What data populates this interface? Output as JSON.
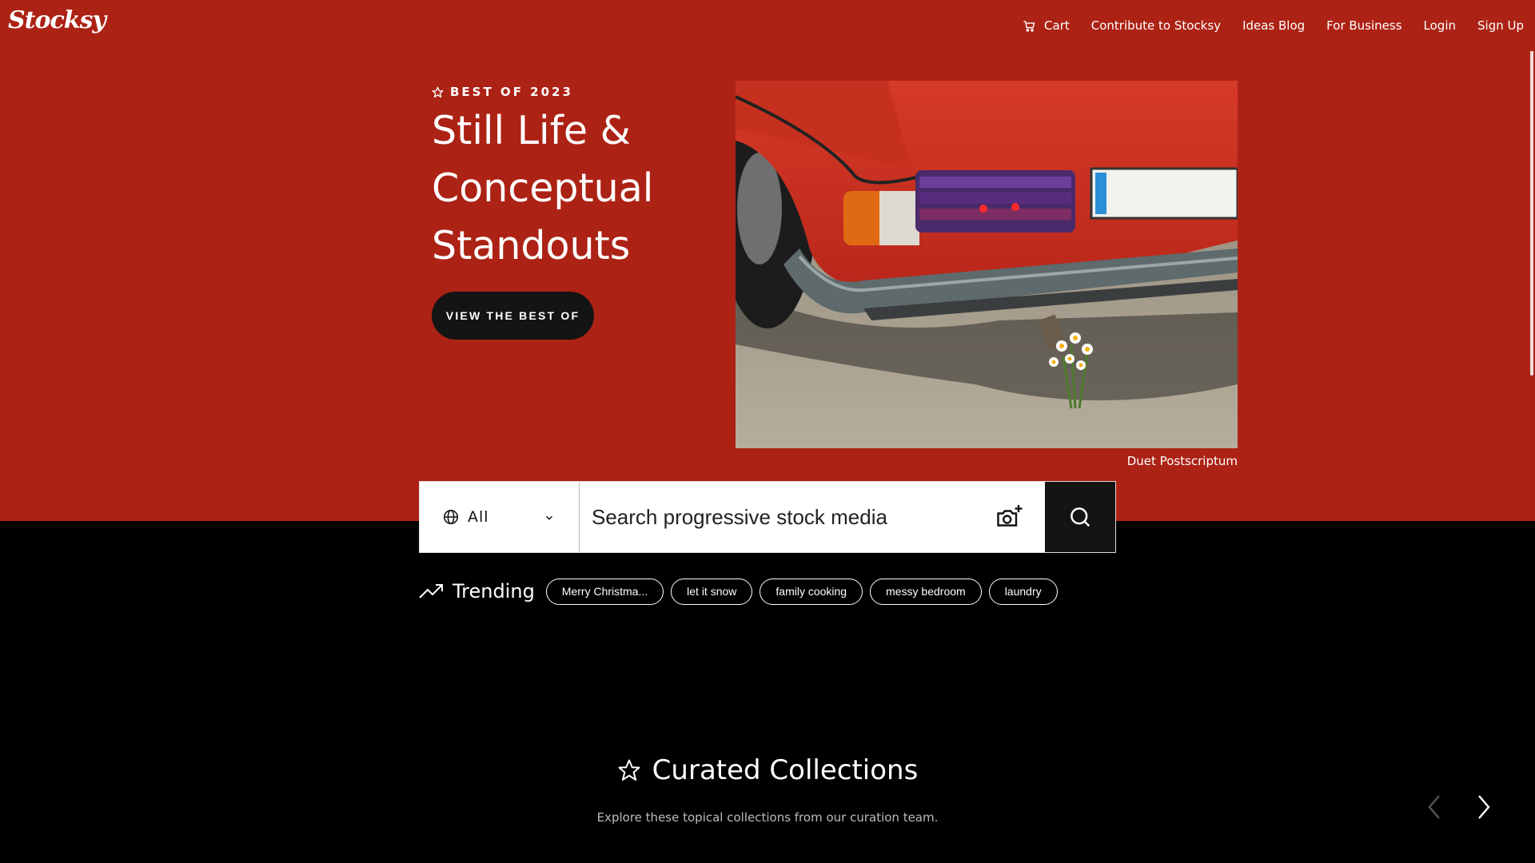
{
  "header": {
    "logo_text": "Stocksy",
    "nav": [
      {
        "label": "Cart",
        "icon": "cart-icon"
      },
      {
        "label": "Contribute to Stocksy"
      },
      {
        "label": "Ideas Blog"
      },
      {
        "label": "For Business"
      },
      {
        "label": "Login"
      },
      {
        "label": "Sign Up"
      }
    ]
  },
  "hero": {
    "eyebrow": "BEST OF 2023",
    "eyebrow_icon": "star-icon",
    "title": "Still Life & Conceptual Standouts",
    "cta_label": "VIEW THE BEST OF",
    "image_credit": "Duet Postscriptum",
    "background_color": "#AC2215"
  },
  "search": {
    "type_label": "All",
    "type_icon": "globe-icon",
    "placeholder": "Search progressive stock media",
    "camera_icon": "camera-plus-icon",
    "submit_icon": "search-icon"
  },
  "trending": {
    "label": "Trending",
    "icon": "trending-up-icon",
    "tags": [
      "Merry Christma...",
      "let it snow",
      "family cooking",
      "messy bedroom",
      "laundry"
    ]
  },
  "curated": {
    "title": "Curated Collections",
    "icon": "star-icon",
    "subtitle": "Explore these topical collections from our curation team."
  },
  "carousel": {
    "prev_icon": "chevron-left-icon",
    "next_icon": "chevron-right-icon"
  }
}
